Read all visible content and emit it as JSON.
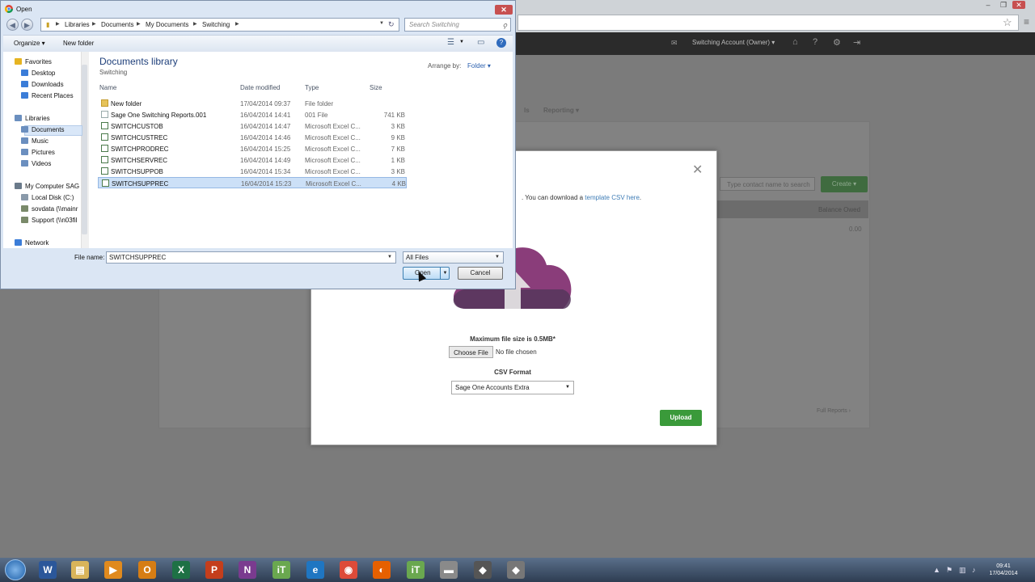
{
  "dialog": {
    "title": "Open",
    "breadcrumb": [
      "Libraries",
      "Documents",
      "My Documents",
      "Switching"
    ],
    "search_placeholder": "Search Switching",
    "toolbar": {
      "organize": "Organize ▾",
      "new_folder": "New folder"
    },
    "nav_pane": [
      {
        "label": "Favorites",
        "icon": "star-icon",
        "level": 0
      },
      {
        "label": "Desktop",
        "icon": "desktop-icon",
        "level": 1
      },
      {
        "label": "Downloads",
        "icon": "downloads-icon",
        "level": 1
      },
      {
        "label": "Recent Places",
        "icon": "recent-places-icon",
        "level": 1
      },
      {
        "label": "Libraries",
        "icon": "libraries-icon",
        "level": 0
      },
      {
        "label": "Documents",
        "icon": "documents-icon",
        "level": 1,
        "selected": true
      },
      {
        "label": "Music",
        "icon": "music-icon",
        "level": 1
      },
      {
        "label": "Pictures",
        "icon": "pictures-icon",
        "level": 1
      },
      {
        "label": "Videos",
        "icon": "videos-icon",
        "level": 1
      },
      {
        "label": "My Computer SAG",
        "icon": "computer-icon",
        "level": 0
      },
      {
        "label": "Local Disk (C:)",
        "icon": "disk-icon",
        "level": 1
      },
      {
        "label": "sovdata (\\\\mainr",
        "icon": "network-drive-icon",
        "level": 1
      },
      {
        "label": "Support (\\\\n03fil",
        "icon": "network-drive-icon",
        "level": 1
      },
      {
        "label": "Network",
        "icon": "network-icon",
        "level": 0
      }
    ],
    "library_title": "Documents library",
    "library_subtitle": "Switching",
    "arrange_by_label": "Arrange by:",
    "arrange_by_value": "Folder ▾",
    "columns": {
      "name": "Name",
      "date": "Date modified",
      "type": "Type",
      "size": "Size"
    },
    "files": [
      {
        "name": "New folder",
        "date": "17/04/2014 09:37",
        "type": "File folder",
        "size": "",
        "kind": "folder"
      },
      {
        "name": "Sage One Switching Reports.001",
        "date": "16/04/2014 14:41",
        "type": "001 File",
        "size": "741 KB",
        "kind": "file"
      },
      {
        "name": "SWITCHCUSTOB",
        "date": "16/04/2014 14:47",
        "type": "Microsoft Excel C...",
        "size": "3 KB",
        "kind": "xls"
      },
      {
        "name": "SWITCHCUSTREC",
        "date": "16/04/2014 14:46",
        "type": "Microsoft Excel C...",
        "size": "9 KB",
        "kind": "xls"
      },
      {
        "name": "SWITCHPRODREC",
        "date": "16/04/2014 15:25",
        "type": "Microsoft Excel C...",
        "size": "7 KB",
        "kind": "xls"
      },
      {
        "name": "SWITCHSERVREC",
        "date": "16/04/2014 14:49",
        "type": "Microsoft Excel C...",
        "size": "1 KB",
        "kind": "xls"
      },
      {
        "name": "SWITCHSUPPOB",
        "date": "16/04/2014 15:34",
        "type": "Microsoft Excel C...",
        "size": "3 KB",
        "kind": "xls"
      },
      {
        "name": "SWITCHSUPPREC",
        "date": "16/04/2014 15:23",
        "type": "Microsoft Excel C...",
        "size": "4 KB",
        "kind": "xls",
        "selected": true
      }
    ],
    "file_name_label": "File name:",
    "file_name_value": "SWITCHSUPPREC",
    "file_type_filter": "All Files",
    "open_label": "Open",
    "cancel_label": "Cancel"
  },
  "browser": {
    "account_menu": "Switching Account (Owner) ▾",
    "nav_tab_fragment": "ls",
    "nav_tab_reporting": "Reporting ▾"
  },
  "page": {
    "contact_search_placeholder": "Type contact name to search",
    "create_label": "Create ▾",
    "balance_header": "Balance Owed",
    "balance_value": "0.00",
    "full_reports_link": "Full Reports ›"
  },
  "modal": {
    "description_text": ". You can download a ",
    "template_link": "template CSV here",
    "description_end": ".",
    "max_size": "Maximum file size is 0.5MB*",
    "choose_file": "Choose File",
    "no_file": "No file chosen",
    "csv_format_label": "CSV Format",
    "csv_format_value": "Sage One Accounts Extra",
    "upload_label": "Upload"
  },
  "taskbar": {
    "time": "09:41",
    "date": "17/04/2014"
  },
  "colors": {
    "upload_green": "#3a9a3a",
    "link_blue": "#3f7db6",
    "cloud_purple": "#8a3d7a",
    "dialog_chrome": "#dbe6f4"
  }
}
